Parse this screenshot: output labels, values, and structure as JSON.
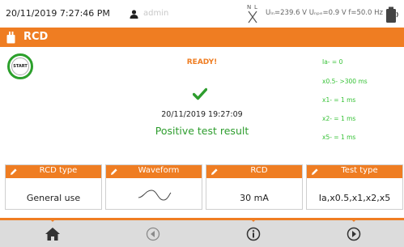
{
  "status_bar": {
    "datetime": "20/11/2019 7:27:46 PM",
    "user": "admin",
    "voltages": "Uₗₙ=239.6 V Uₙₚₑ=0.9 V f=50.0 Hz"
  },
  "title": "RCD",
  "main": {
    "ready": "READY!",
    "start_label": "START",
    "datetime": "20/11/2019 19:27:09",
    "result": "Positive test result",
    "measurements": [
      "Ia- = 0",
      "x0.5- >300 ms",
      "x1- = 1 ms",
      "x2- = 1 ms",
      "x5- = 1 ms"
    ]
  },
  "params": [
    {
      "label": "RCD type",
      "value": "General use"
    },
    {
      "label": "Waveform",
      "value": ""
    },
    {
      "label": "RCD",
      "value": "30 mA"
    },
    {
      "label": "Test type",
      "value": "Ia,x0.5,x1,x2,x5"
    }
  ],
  "colors": {
    "accent": "#ef7d22",
    "ok": "#2e9d2e",
    "bottom_bar": "#dcdcdc"
  },
  "icons": {
    "status": [
      "user-icon",
      "plug-icon",
      "battery-icon"
    ],
    "bottom": [
      "home-icon",
      "back-icon",
      "info-icon",
      "next-icon"
    ]
  }
}
